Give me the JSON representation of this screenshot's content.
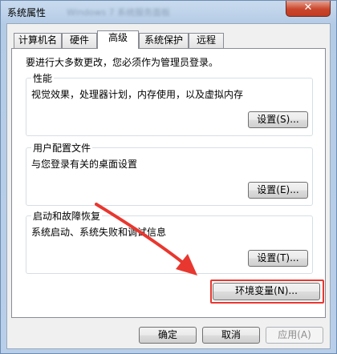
{
  "window": {
    "title": "系统属性",
    "background_title": "Windows 7 系统服务面板",
    "close_glyph": "✕"
  },
  "tabs": [
    {
      "label": "计算机名",
      "active": false
    },
    {
      "label": "硬件",
      "active": false
    },
    {
      "label": "高级",
      "active": true
    },
    {
      "label": "系统保护",
      "active": false
    },
    {
      "label": "远程",
      "active": false
    }
  ],
  "admin_note": "要进行大多数更改，您必须作为管理员登录。",
  "groups": {
    "performance": {
      "title": "性能",
      "description": "视觉效果，处理器计划，内存使用，以及虚拟内存",
      "button": "设置(S)..."
    },
    "user_profiles": {
      "title": "用户配置文件",
      "description": "与您登录有关的桌面设置",
      "button": "设置(E)..."
    },
    "startup_recovery": {
      "title": "启动和故障恢复",
      "description": "系统启动、系统失败和调试信息",
      "button": "设置(T)..."
    }
  },
  "env_button": "环境变量(N)...",
  "footer": {
    "ok": "确定",
    "cancel": "取消",
    "apply": "应用(A)"
  },
  "colors": {
    "annotation": "#e8372f",
    "accent": "#c9462c"
  }
}
